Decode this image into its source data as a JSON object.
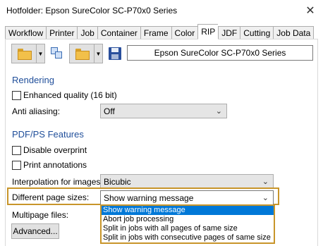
{
  "window": {
    "title": "Hotfolder: Epson SureColor SC-P70x0 Series",
    "close_glyph": "✕"
  },
  "tabs": [
    {
      "label": "Workflow"
    },
    {
      "label": "Printer"
    },
    {
      "label": "Job"
    },
    {
      "label": "Container"
    },
    {
      "label": "Frame"
    },
    {
      "label": "Color"
    },
    {
      "label": "RIP"
    },
    {
      "label": "JDF"
    },
    {
      "label": "Cutting"
    },
    {
      "label": "Job Data"
    }
  ],
  "active_tab": "RIP",
  "toolbar": {
    "device_name": "Epson SureColor SC-P70x0 Series"
  },
  "rendering": {
    "heading": "Rendering",
    "enhanced_quality_label": "Enhanced quality (16 bit)",
    "anti_aliasing_label": "Anti aliasing:",
    "anti_aliasing_value": "Off"
  },
  "pdfps": {
    "heading": "PDF/PS Features",
    "disable_overprint_label": "Disable overprint",
    "print_annotations_label": "Print annotations",
    "interpolation_label": "Interpolation for images:",
    "interpolation_value": "Bicubic",
    "page_sizes_label": "Different page sizes:",
    "page_sizes_value": "Show warning message",
    "page_sizes_options": [
      "Show warning message",
      "Abort job processing",
      "Split in jobs with all pages of same size",
      "Split in jobs with consecutive pages of same size"
    ],
    "multipage_label": "Multipage files:",
    "advanced_button": "Advanced..."
  },
  "colors": {
    "accent_highlight": "#c8952a",
    "heading_blue": "#1f4e9a",
    "selection_blue": "#0078d7"
  },
  "icons": [
    "open-folder-icon",
    "multi-window-icon",
    "folder-icon",
    "save-icon",
    "close-icon",
    "chevron-down-icon"
  ]
}
